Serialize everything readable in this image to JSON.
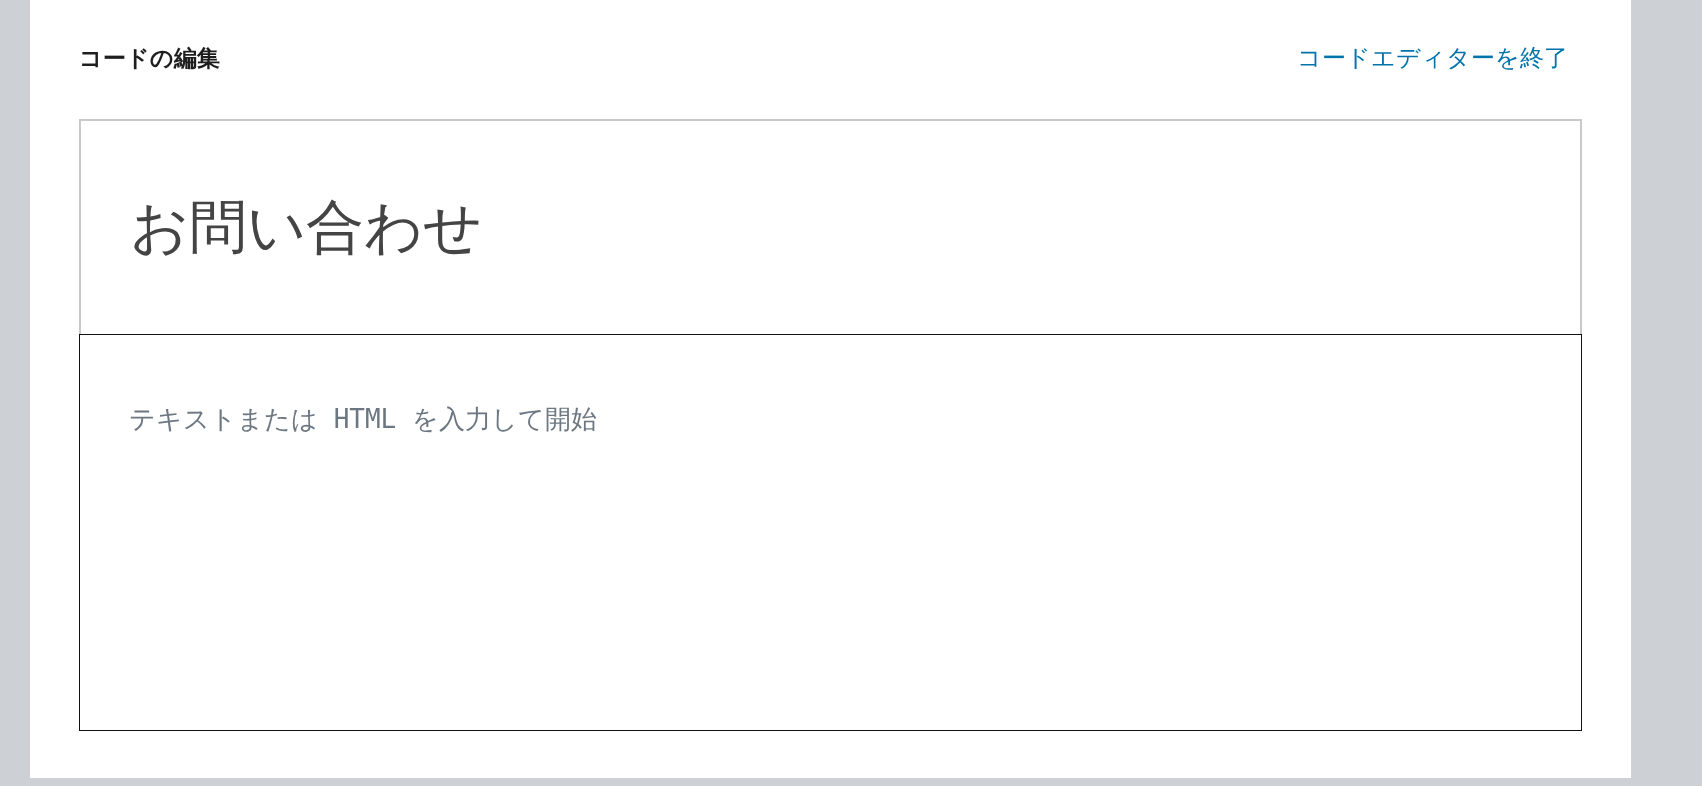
{
  "header": {
    "title": "コードの編集",
    "exit_link": "コードエディターを終了"
  },
  "editor": {
    "title": "お問い合わせ",
    "code_field": {
      "placeholder": "テキストまたは HTML を入力して開始"
    }
  }
}
